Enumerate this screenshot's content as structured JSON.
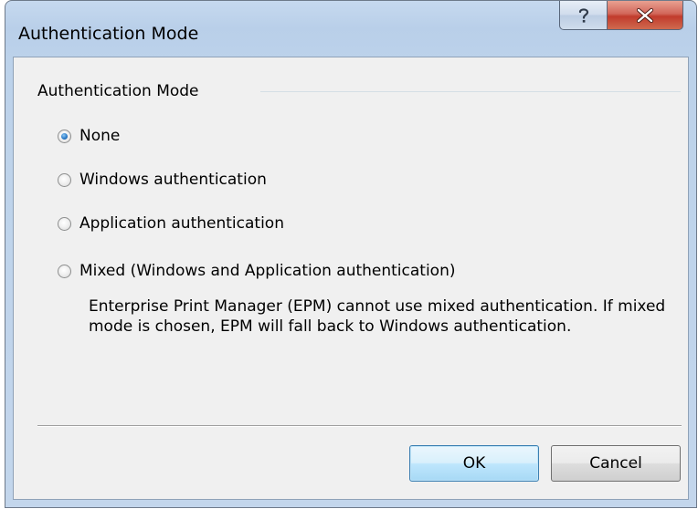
{
  "window": {
    "title": "Authentication Mode",
    "help_glyph": "?",
    "close_glyph": "✕"
  },
  "group": {
    "label": "Authentication Mode"
  },
  "options": [
    {
      "label": "None",
      "checked": true
    },
    {
      "label": "Windows authentication",
      "checked": false
    },
    {
      "label": "Application authentication",
      "checked": false
    },
    {
      "label": "Mixed (Windows and Application authentication)",
      "checked": false
    }
  ],
  "note": "Enterprise Print Manager (EPM) cannot use mixed authentication. If mixed mode is chosen, EPM will fall back to Windows authentication.",
  "buttons": {
    "ok": "OK",
    "cancel": "Cancel"
  },
  "colors": {
    "frame": "#bcd2ea",
    "close_button": "#c13b2c",
    "client": "#f0f0f0",
    "default_button_border": "#3c7fb1",
    "radio_selected": "#2b7bc8"
  },
  "icons": {
    "help": "help-icon",
    "close": "close-icon"
  }
}
